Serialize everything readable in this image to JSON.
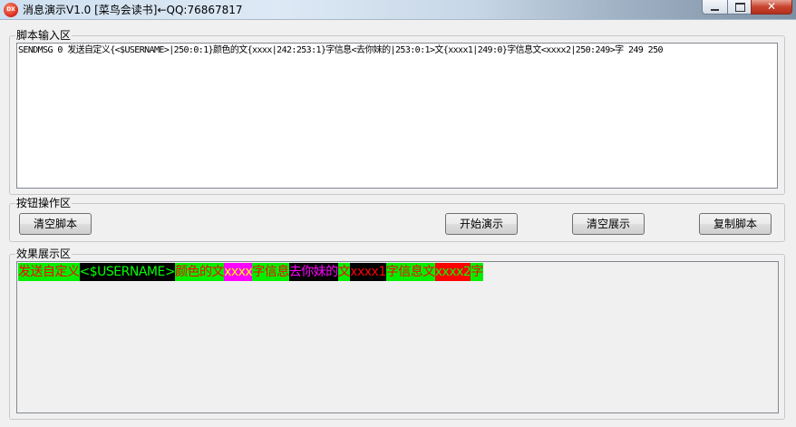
{
  "window": {
    "title": "消息演示V1.0 [菜鸟会读书]←QQ:76867817",
    "icon": "dx-app-icon",
    "icon_text": "DX",
    "close_glyph": "✕"
  },
  "script_group": {
    "label": "脚本输入区",
    "text": "SENDMSG 0 发送自定义{<$USERNAME>|250:0:1}颜色的文{xxxx|242:253:1}字信息<去你妹的|253:0:1>文{xxxx1|249:0}字信息文<xxxx2|250:249>字 249 250"
  },
  "button_group": {
    "label": "按钮操作区",
    "clear_script": "清空脚本",
    "start_demo": "开始演示",
    "clear_display": "清空展示",
    "copy_script": "复制脚本"
  },
  "display_group": {
    "label": "效果展示区",
    "segments": [
      {
        "text": "发送自定义",
        "fg": "#ff0000",
        "bg": "#00ee00"
      },
      {
        "text": "<$USERNAME>",
        "fg": "#00ff00",
        "bg": "#000000"
      },
      {
        "text": "颜色的文",
        "fg": "#ff0000",
        "bg": "#00ee00"
      },
      {
        "text": "xxxx",
        "fg": "#ffff00",
        "bg": "#ff00ff"
      },
      {
        "text": "字信息",
        "fg": "#ff0000",
        "bg": "#00ee00"
      },
      {
        "text": "去你妹的",
        "fg": "#ff00ff",
        "bg": "#000000"
      },
      {
        "text": "文",
        "fg": "#ff0000",
        "bg": "#00ee00"
      },
      {
        "text": "xxxx1",
        "fg": "#ff0000",
        "bg": "#000000"
      },
      {
        "text": "字信息文",
        "fg": "#ff0000",
        "bg": "#00ee00"
      },
      {
        "text": "xxxx2",
        "fg": "#00ff00",
        "bg": "#ff0000"
      },
      {
        "text": "字",
        "fg": "#ff0000",
        "bg": "#00ee00"
      }
    ]
  }
}
